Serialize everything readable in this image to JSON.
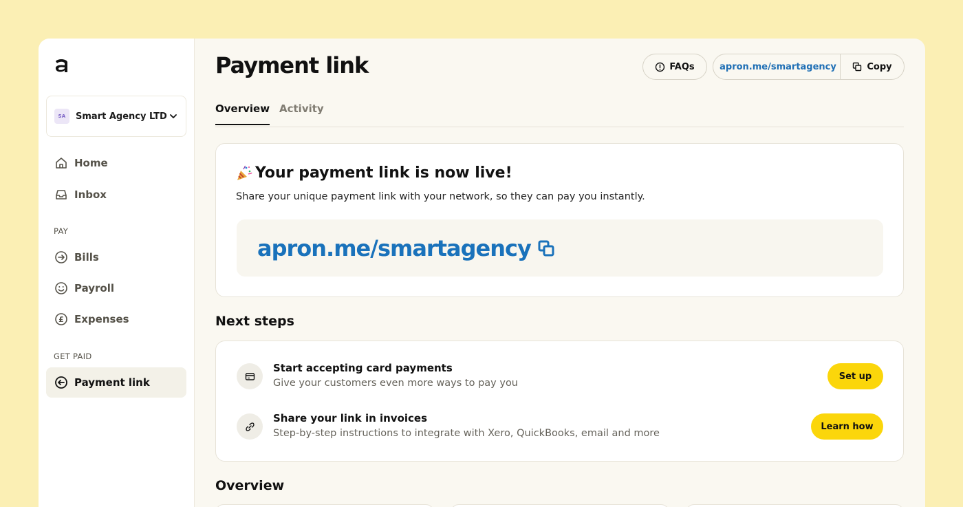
{
  "sidebar": {
    "org": {
      "badge": "SA",
      "name": "Smart Agency LTD"
    },
    "nav": {
      "home": "Home",
      "inbox": "Inbox",
      "pay_section": "PAY",
      "bills": "Bills",
      "payroll": "Payroll",
      "expenses": "Expenses",
      "get_paid_section": "GET PAID",
      "payment_link": "Payment link"
    }
  },
  "header": {
    "title": "Payment link",
    "faqs_label": "FAQs",
    "link_url": "apron.me/smartagency",
    "copy_label": "Copy"
  },
  "tabs": {
    "overview": "Overview",
    "activity": "Activity"
  },
  "live_card": {
    "title": "Your payment link is now live!",
    "subtitle": "Share your unique payment link with your network, so they can pay you instantly.",
    "link": "apron.me/smartagency"
  },
  "next_steps": {
    "title": "Next steps",
    "items": [
      {
        "title": "Start accepting card payments",
        "description": "Give your customers even more ways to pay you",
        "button": "Set up"
      },
      {
        "title": "Share your link in invoices",
        "description": "Step-by-step instructions to integrate with Xero, QuickBooks, email and more",
        "button": "Learn how"
      }
    ]
  },
  "overview_section": {
    "title": "Overview"
  },
  "colors": {
    "accent_yellow": "#fbd60b",
    "link_blue": "#1a72bb",
    "page_bg": "#fbefb4"
  }
}
